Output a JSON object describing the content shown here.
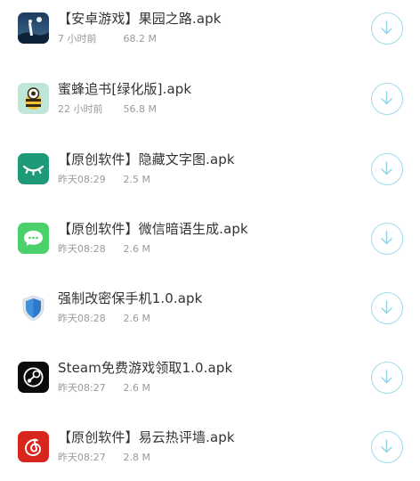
{
  "colors": {
    "title": "#333333",
    "meta": "#9a9a9a",
    "download_ring": "#9fdcec"
  },
  "files": [
    {
      "title": "【安卓游戏】果园之路.apk",
      "time": "7 小时前",
      "size": "68.2 M",
      "icon": "game-night-scene-icon"
    },
    {
      "title": "蜜蜂追书[绿化版].apk",
      "time": "22 小时前",
      "size": "56.8 M",
      "icon": "bee-reader-icon"
    },
    {
      "title": "【原创软件】隐藏文字图.apk",
      "time": "昨天08:29",
      "size": "2.5 M",
      "icon": "closed-eye-icon"
    },
    {
      "title": "【原创软件】微信暗语生成.apk",
      "time": "昨天08:28",
      "size": "2.6 M",
      "icon": "chat-bubble-icon"
    },
    {
      "title": "强制改密保手机1.0.apk",
      "time": "昨天08:28",
      "size": "2.6 M",
      "icon": "shield-icon"
    },
    {
      "title": "Steam免费游戏领取1.0.apk",
      "time": "昨天08:27",
      "size": "2.6 M",
      "icon": "steam-icon"
    },
    {
      "title": "【原创软件】易云热评墙.apk",
      "time": "昨天08:27",
      "size": "2.8 M",
      "icon": "netease-music-icon"
    }
  ]
}
